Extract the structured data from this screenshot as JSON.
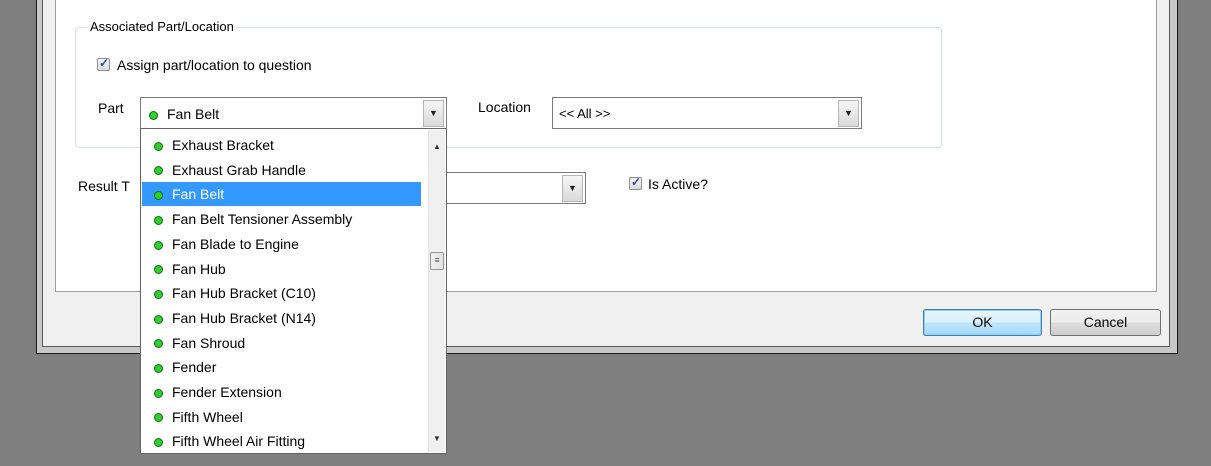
{
  "groupbox": {
    "title": "Associated Part/Location",
    "assign_label": "Assign part/location to question",
    "assign_checked": true
  },
  "part": {
    "label": "Part",
    "value": "Fan Belt"
  },
  "location": {
    "label": "Location",
    "value": "<< All >>"
  },
  "result_type": {
    "label": "Result T"
  },
  "active": {
    "label": "Is Active?",
    "checked": true
  },
  "buttons": {
    "ok": "OK",
    "cancel": "Cancel"
  },
  "part_list": {
    "items": [
      "Exhaust Bracket",
      "Exhaust Grab Handle",
      "Fan Belt",
      "Fan Belt Tensioner Assembly",
      "Fan Blade to Engine",
      "Fan Hub",
      "Fan Hub Bracket (C10)",
      "Fan Hub Bracket (N14)",
      "Fan Shroud",
      "Fender",
      "Fender Extension",
      "Fifth Wheel",
      "Fifth Wheel Air Fitting"
    ],
    "selected": "Fan Belt",
    "bullet_color": "#2fcf2f",
    "highlight_color": "#3399ff"
  },
  "icons": {
    "dropdown_arrow": "chevron-down-icon",
    "scroll_up": "chevron-up-icon",
    "scroll_down": "chevron-down-icon",
    "checkmark": "checkmark-icon",
    "bullet": "status-dot-icon"
  }
}
